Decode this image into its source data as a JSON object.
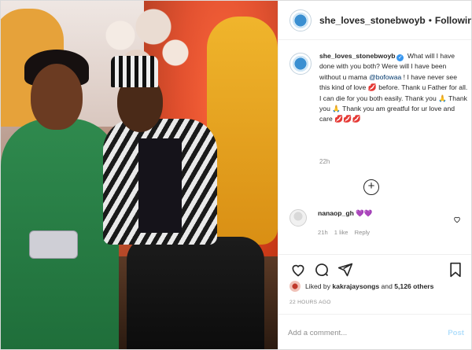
{
  "header": {
    "username": "she_loves_stonebwoyb",
    "separator": "•",
    "follow_label": "Following"
  },
  "caption": {
    "username": "she_loves_stonebwoyb",
    "verified_glyph": "✓",
    "text_before_mention": "What will I have done with you both? Were will I have been without u mama",
    "mention": "@bofowaa",
    "text_after_mention": "! I have never see this kind of love",
    "text_after_heart": "before. Thank u Father for all. I can die for you both easily. Thank you 🙏 Thank you 🙏 Thank you am greatful for ur love and care",
    "heart_glyph": "💋",
    "end_hearts": "💋💋💋",
    "time": "22h"
  },
  "load_more": {
    "glyph": "+"
  },
  "comment": {
    "username": "nanaop_gh",
    "text": "💜💜",
    "time": "21h",
    "likes": "1 like",
    "reply": "Reply"
  },
  "likes": {
    "prefix": "Liked by",
    "user": "kakrajaysongs",
    "middle": "and",
    "count": "5,126 others"
  },
  "post_time": "22 HOURS AGO",
  "add_comment": {
    "placeholder": "Add a comment...",
    "post_label": "Post"
  },
  "icons": {
    "heart": "heart-icon",
    "comment": "comment-icon",
    "share": "share-icon",
    "save": "bookmark-icon"
  },
  "colors": {
    "link": "#00376b",
    "post_disabled": "#b2dffc",
    "verified": "#3897f0",
    "muted": "#8e8e8e"
  }
}
